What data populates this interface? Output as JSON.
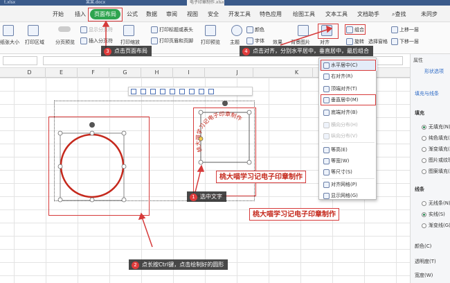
{
  "file_tabs": [
    "t.xlsx",
    "某某.docx",
    "电子印章制作.xlsx"
  ],
  "menu": {
    "tabs": [
      "开始",
      "插入",
      "页面布局",
      "公式",
      "数据",
      "审阅",
      "视图",
      "安全",
      "开发工具",
      "特色应用",
      "绘图工具",
      "文本工具",
      "文档助手"
    ],
    "search": "查找",
    "sync": "未同步"
  },
  "ribbon": {
    "paper_size": "纸张大小",
    "print_area": "打印区域",
    "page_preview": "分页预览",
    "show_breaks": "显示分页符",
    "insert_break": "插入分页符",
    "print_scale": "打印缩放",
    "print_titles": "打印标题或表头",
    "print_header_footer": "打印页眉和页脚",
    "print_preview": "打印预览",
    "theme": "主题",
    "colors": "颜色",
    "fonts": "字体",
    "effects": "效果",
    "background": "背景图片",
    "align": "对齐",
    "group": "组合",
    "rotate": "旋转",
    "selection_pane": "选择窗格",
    "bring_forward": "上移一层",
    "send_backward": "下移一层"
  },
  "columns": [
    "D",
    "E",
    "F",
    "G",
    "H",
    "I",
    "J",
    "K"
  ],
  "dropdown": {
    "items": [
      "水平居中(C)",
      "右对齐(R)",
      "顶端对齐(T)",
      "垂直居中(M)",
      "底端对齐(B)",
      "横向分布(H)",
      "纵向分布(V)",
      "等高(E)",
      "等宽(W)",
      "等尺寸(S)",
      "对齐网格(P)",
      "显示网格(G)"
    ]
  },
  "panel": {
    "title": "属性",
    "tab_shape": "形状选项",
    "fill_line": "填充与线条",
    "fill_label": "填充",
    "fill_options": [
      "无填充(N)",
      "纯色填充(S)",
      "渐变填充(G)",
      "图片或纹理填充",
      "图案填充(A)"
    ],
    "line_label": "线条",
    "line_options": [
      "无线条(N)",
      "实线(S)",
      "渐变线(G)"
    ],
    "color": "颜色(C)",
    "transparency": "透明度(T)",
    "width": "宽度(W)"
  },
  "callouts": {
    "c1": {
      "num": "1",
      "text": "选中文字"
    },
    "c2": {
      "num": "2",
      "text": "点长按Ctrl键，点击绘制好的圆形"
    },
    "c3": {
      "num": "3",
      "text": "点击页面布局"
    },
    "c4": {
      "num": "4",
      "text": "点击对齐，分别水平居中，垂直居中，最后组合"
    }
  },
  "stamp_text": "桃大喵学习记电子印章制作",
  "arc_text": "桃大喵学习记电子印章制作",
  "colors": {
    "accent": "#2ea44f",
    "red": "#d63a3a",
    "stamp": "#c5281c"
  }
}
